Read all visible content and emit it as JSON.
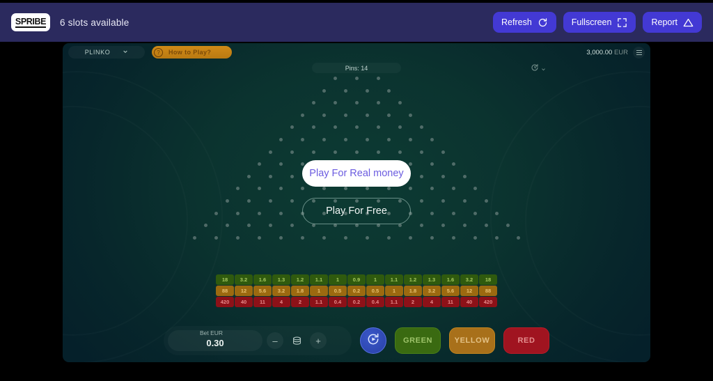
{
  "topbar": {
    "logo_text": "SPRIBE",
    "slots_text": "6 slots available",
    "buttons": [
      {
        "label": "Refresh",
        "icon": "refresh-icon"
      },
      {
        "label": "Fullscreen",
        "icon": "fullscreen-icon"
      },
      {
        "label": "Report",
        "icon": "warning-triangle-icon"
      }
    ]
  },
  "game": {
    "title_select": "PLINKO",
    "how_to_play": "How to Play?",
    "how_to_play_mark": "?",
    "balance_amount": "3,000.00",
    "balance_currency": "EUR",
    "pins_label": "Pins: 14",
    "overlay": {
      "play_real": "Play For Real money",
      "play_free": "Play For Free"
    },
    "multipliers": {
      "green": [
        "18",
        "3.2",
        "1.6",
        "1.3",
        "1.2",
        "1.1",
        "1",
        "0.9",
        "1",
        "1.1",
        "1.2",
        "1.3",
        "1.6",
        "3.2",
        "18"
      ],
      "yellow": [
        "88",
        "12",
        "5.6",
        "3.2",
        "1.8",
        "1",
        "0.5",
        "0.2",
        "0.5",
        "1",
        "1.8",
        "3.2",
        "5.6",
        "12",
        "88"
      ],
      "red": [
        "420",
        "40",
        "11",
        "4",
        "2",
        "1.1",
        "0.4",
        "0.2",
        "0.4",
        "1.1",
        "2",
        "4",
        "11",
        "40",
        "420"
      ]
    },
    "controls": {
      "bet_label": "Bet EUR",
      "bet_value": "0.30",
      "minus": "–",
      "plus": "+",
      "chip_icon": "chips-icon",
      "auto_icon": "auto-play-icon",
      "bet_buttons": [
        {
          "label": "GREEN",
          "color": "#3a6a11"
        },
        {
          "label": "YELLOW",
          "color": "#a8701a"
        },
        {
          "label": "RED",
          "color": "#a01420"
        }
      ]
    },
    "pin_rows": [
      3,
      4,
      5,
      6,
      7,
      8,
      9,
      10,
      11,
      12,
      13,
      14,
      15,
      16
    ]
  }
}
